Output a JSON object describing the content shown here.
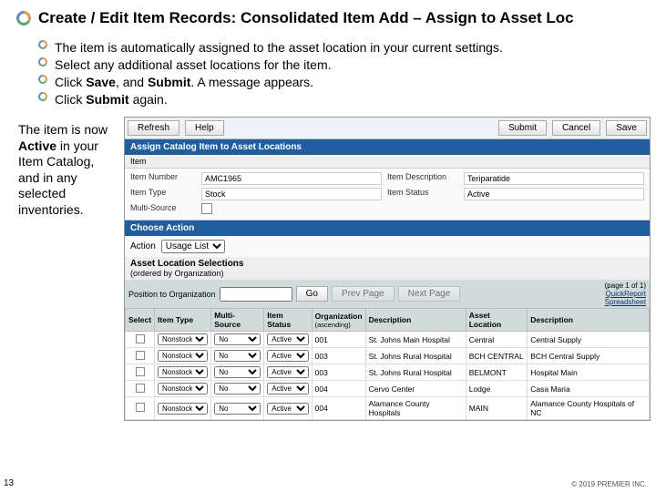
{
  "title": "Create / Edit Item Records: Consolidated Item Add – Assign to Asset Loc",
  "bullets": [
    {
      "pre": "The item is automatically assigned to the asset location in your current settings.",
      "bold": "",
      "post": ""
    },
    {
      "pre": "Select any additional asset locations for the item.",
      "bold": "",
      "post": ""
    },
    {
      "pre": "Click ",
      "bold": "Save",
      "mid": ", and ",
      "bold2": "Submit",
      "post": ". A message appears."
    },
    {
      "pre": "Click ",
      "bold": "Submit",
      "post": " again."
    }
  ],
  "side_note": {
    "pre": "The item is now ",
    "bold": "Active",
    "post": " in your Item Catalog, and in any selected inventories."
  },
  "toolbar": {
    "refresh": "Refresh",
    "help": "Help",
    "submit": "Submit",
    "cancel": "Cancel",
    "save": "Save"
  },
  "panel_title": "Assign Catalog Item to Asset Locations",
  "item_section": "Item",
  "form": {
    "item_number_label": "Item Number",
    "item_number": "AMC1965",
    "item_desc_label": "Item Description",
    "item_desc": "Teriparatide",
    "item_type_label": "Item Type",
    "item_type": "Stock",
    "item_status_label": "Item Status",
    "item_status": "Active",
    "multi_source_label": "Multi-Source"
  },
  "choose_action": "Choose Action",
  "action_label": "Action",
  "action_value": "Usage List",
  "selections": {
    "title": "Asset Location Selections",
    "sub": "(ordered by Organization)"
  },
  "pager": {
    "pos_label": "Position to Organization",
    "go": "Go",
    "prev": "Prev Page",
    "next": "Next Page",
    "page": "(page 1 of 1)",
    "quick": "QuickReport",
    "sheet": "Spreadsheet"
  },
  "columns": {
    "select": "Select",
    "item_type": "Item Type",
    "multi": "Multi-Source",
    "status": "Item Status",
    "org": "Organization",
    "org2": "(ascending)",
    "desc": "Description",
    "asset": "Asset Location",
    "adesc": "Description"
  },
  "rows": [
    {
      "type": "Nonstock",
      "multi": "No",
      "status": "Active",
      "org": "001",
      "desc": "St. Johns Main Hospital",
      "asset": "Central",
      "adesc": "Central Supply"
    },
    {
      "type": "Nonstock",
      "multi": "No",
      "status": "Active",
      "org": "003",
      "desc": "St. Johns Rural Hospital",
      "asset": "BCH CENTRAL",
      "adesc": "BCH Central Supply"
    },
    {
      "type": "Nonstock",
      "multi": "No",
      "status": "Active",
      "org": "003",
      "desc": "St. Johns Rural Hospital",
      "asset": "BELMONT",
      "adesc": "Hospital Main"
    },
    {
      "type": "Nonstock",
      "multi": "No",
      "status": "Active",
      "org": "004",
      "desc": "Cervo Center",
      "asset": "Lodge",
      "adesc": "Casa Maria"
    },
    {
      "type": "Nonstock",
      "multi": "No",
      "status": "Active",
      "org": "004",
      "desc": "Alamance County Hospitals",
      "asset": "MAIN",
      "adesc": "Alamance County Hospitals of NC"
    }
  ],
  "page_number": "13",
  "copyright": "© 2019 PREMIER INC."
}
